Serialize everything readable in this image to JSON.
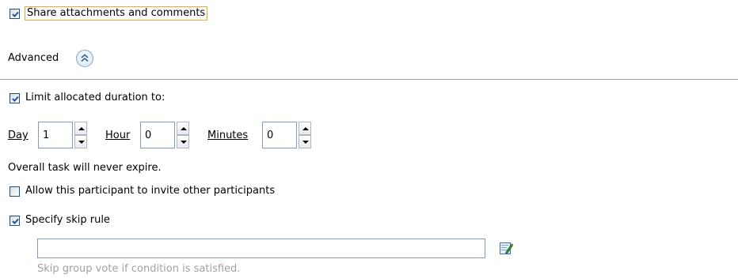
{
  "share": {
    "label": "Share attachments and comments",
    "checked": true
  },
  "advanced": {
    "label": "Advanced",
    "toggle_icon": "double-chevron-up-icon"
  },
  "limit": {
    "label": "Limit allocated duration to:",
    "checked": true
  },
  "duration": {
    "day": {
      "label": "Day",
      "value": "1"
    },
    "hour": {
      "label": "Hour",
      "value": "0"
    },
    "minutes": {
      "label": "Minutes",
      "value": "0"
    }
  },
  "expire_note": "Overall task will never expire.",
  "allow_invite": {
    "label": "Allow this participant to invite other participants",
    "checked": false
  },
  "skip_rule": {
    "label": "Specify skip rule",
    "checked": true
  },
  "skip_condition": {
    "value": "",
    "edit_icon": "edit-expression-icon",
    "hint": "Skip group vote if condition is satisfied."
  },
  "colors": {
    "focus": "#f0a830",
    "check": "#2152a3",
    "hint": "#a0a0a0",
    "border": "#7f9db9"
  }
}
